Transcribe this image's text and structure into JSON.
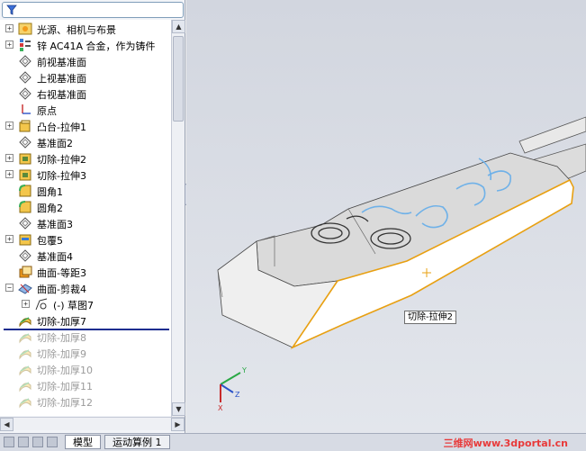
{
  "tree": {
    "items": [
      {
        "label": "光源、相机与布景",
        "icon": "scene-icon",
        "expander": "+"
      },
      {
        "label": "锌 AC41A 合金，作为铸件",
        "icon": "material-icon",
        "expander": "+"
      },
      {
        "label": "前视基准面",
        "icon": "plane-icon",
        "expander": ""
      },
      {
        "label": "上视基准面",
        "icon": "plane-icon",
        "expander": ""
      },
      {
        "label": "右视基准面",
        "icon": "plane-icon",
        "expander": ""
      },
      {
        "label": "原点",
        "icon": "origin-icon",
        "expander": ""
      },
      {
        "label": "凸台-拉伸1",
        "icon": "boss-extrude-icon",
        "expander": "+"
      },
      {
        "label": "基准面2",
        "icon": "plane-icon",
        "expander": ""
      },
      {
        "label": "切除-拉伸2",
        "icon": "cut-extrude-icon",
        "expander": "+"
      },
      {
        "label": "切除-拉伸3",
        "icon": "cut-extrude-icon",
        "expander": "+"
      },
      {
        "label": "圆角1",
        "icon": "fillet-icon",
        "expander": ""
      },
      {
        "label": "圆角2",
        "icon": "fillet-icon",
        "expander": ""
      },
      {
        "label": "基准面3",
        "icon": "plane-icon",
        "expander": ""
      },
      {
        "label": "包覆5",
        "icon": "wrap-icon",
        "expander": "+"
      },
      {
        "label": "基准面4",
        "icon": "plane-icon",
        "expander": ""
      },
      {
        "label": "曲面-等距3",
        "icon": "offset-surface-icon",
        "expander": ""
      },
      {
        "label": "曲面-剪裁4",
        "icon": "trim-surface-icon",
        "expander": "−"
      },
      {
        "label": "(-) 草图7",
        "icon": "sketch-icon",
        "expander": "+",
        "sub": true
      },
      {
        "label": "切除-加厚7",
        "icon": "thicken-cut-icon",
        "expander": ""
      },
      {
        "label": "切除-加厚8",
        "icon": "thicken-cut-icon",
        "expander": "",
        "suppressed": true
      },
      {
        "label": "切除-加厚9",
        "icon": "thicken-cut-icon",
        "expander": "",
        "suppressed": true
      },
      {
        "label": "切除-加厚10",
        "icon": "thicken-cut-icon",
        "expander": "",
        "suppressed": true
      },
      {
        "label": "切除-加厚11",
        "icon": "thicken-cut-icon",
        "expander": "",
        "suppressed": true
      },
      {
        "label": "切除-加厚12",
        "icon": "thicken-cut-icon",
        "expander": "",
        "suppressed": true
      }
    ]
  },
  "viewport": {
    "tooltip": "切除-拉伸2",
    "triad": {
      "x": "X",
      "y": "Y",
      "z": "Z"
    },
    "colors": {
      "highlight": "#e8a012",
      "body": "#d9d9d9",
      "relief": "#6fb1e8"
    }
  },
  "bottom": {
    "tabs": [
      {
        "label": "模型",
        "active": true
      },
      {
        "label": "运动算例 1",
        "active": false
      }
    ],
    "watermark": "三维网www.3dportal.cn"
  }
}
